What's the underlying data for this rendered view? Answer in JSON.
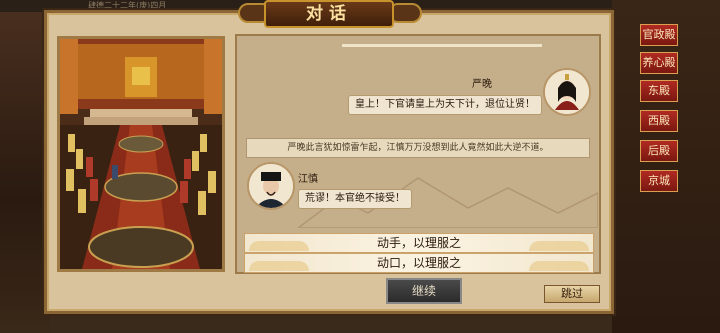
{
  "background": {
    "top_strip_text": "肆德二十二年(庚)四月",
    "side_buttons": [
      "官政殿",
      "养心殿",
      "东殿",
      "西殿",
      "后殿",
      "京城"
    ]
  },
  "dialog": {
    "title": "对话"
  },
  "chat": {
    "messages": [
      {
        "speaker": "严晚",
        "text": "皇上！下官请皇上为天下计，退位让贤！",
        "side": "right"
      },
      {
        "speaker": "江慎",
        "text": "荒谬！本官绝不接受！",
        "side": "left"
      }
    ],
    "narration": "严晚此言犹如惊雷乍起，江慎万万没想到此人竟然如此大逆不道。"
  },
  "choices": [
    {
      "label": "动手，以理服之"
    },
    {
      "label": "动口，以理服之"
    }
  ],
  "buttons": {
    "continue_label": "继续",
    "skip_label": "跳过"
  },
  "icons": {
    "avatar_yanwan": "female-official-portrait",
    "avatar_jiangshen": "male-official-portrait"
  },
  "colors": {
    "frame": "#8b6634",
    "panel": "#c5ae8a",
    "title": "#fbe1a0",
    "side_button": "#b02a22"
  }
}
